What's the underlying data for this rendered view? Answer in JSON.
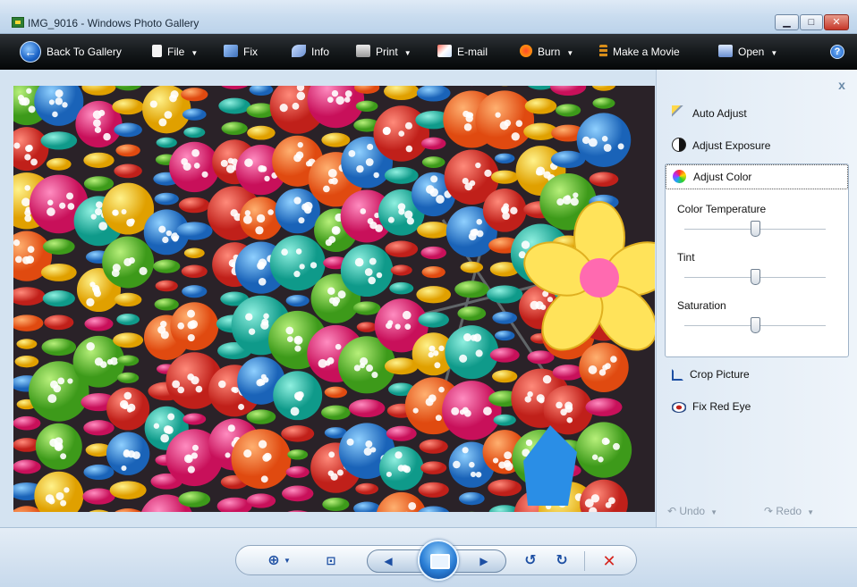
{
  "window": {
    "title": "IMG_9016 - Windows Photo Gallery"
  },
  "caption_buttons": {
    "minimize": "▁",
    "maximize": "□",
    "close": "✕"
  },
  "toolbar": {
    "back": "Back To Gallery",
    "file": "File",
    "fix": "Fix",
    "info": "Info",
    "print": "Print",
    "email": "E-mail",
    "burn": "Burn",
    "movie": "Make a Movie",
    "open": "Open",
    "help": "?"
  },
  "fix_pane": {
    "close": "x",
    "auto_adjust": "Auto Adjust",
    "adjust_exposure": "Adjust Exposure",
    "adjust_color": "Adjust Color",
    "sliders": [
      {
        "label": "Color Temperature",
        "value": 0.5
      },
      {
        "label": "Tint",
        "value": 0.5
      },
      {
        "label": "Saturation",
        "value": 0.5
      }
    ],
    "crop_picture": "Crop Picture",
    "fix_red_eye": "Fix Red Eye",
    "undo": "Undo",
    "redo": "Redo"
  },
  "photo": {
    "subject": "colorful wooden bead strings"
  },
  "bottom_controls": {
    "zoom": "⊕",
    "actual_size": "⊡",
    "previous": "◀",
    "next": "▶",
    "rotate_ccw": "↺",
    "rotate_cw": "↻",
    "delete": "✕"
  },
  "colors": {
    "toolbar": "#15191c",
    "pane": "#e4eef8",
    "accent": "#1d4fa3",
    "delete": "#d6261e"
  }
}
